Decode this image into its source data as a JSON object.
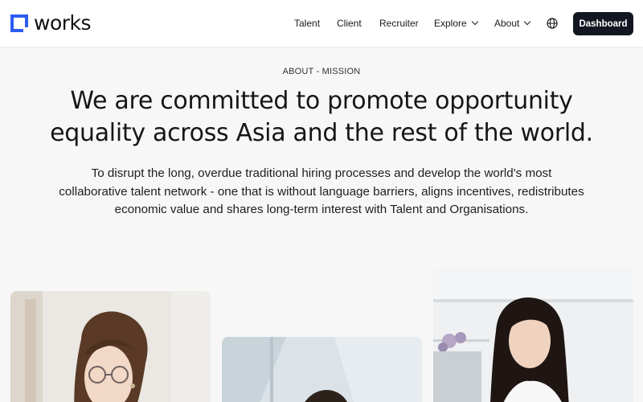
{
  "brand": {
    "name": "works",
    "logo_icon": "works-logo-mark",
    "accent": "#2f5cf0"
  },
  "nav": {
    "items": [
      {
        "label": "Talent",
        "has_dropdown": false
      },
      {
        "label": "Client",
        "has_dropdown": false
      },
      {
        "label": "Recruiter",
        "has_dropdown": false
      },
      {
        "label": "Explore",
        "has_dropdown": true
      },
      {
        "label": "About",
        "has_dropdown": true
      }
    ],
    "language_icon": "globe-icon",
    "cta_label": "Dashboard",
    "cta_color": "#131722"
  },
  "hero": {
    "eyebrow": "ABOUT - MISSION",
    "headline_line1": "We are committed to promote opportunity",
    "headline_line2": "equality across Asia and the rest of the world.",
    "desc_line1": "To disrupt the long, overdue traditional hiring processes and develop the world's most",
    "desc_line2": "collaborative talent network - one that is without language barriers, aligns incentives, redistributes",
    "desc_line3": "economic value and shares long-term interest with Talent and Organisations."
  },
  "photos": [
    {
      "subject": "woman-with-glasses-photo"
    },
    {
      "subject": "person-by-window-photo"
    },
    {
      "subject": "woman-long-hair-photo"
    }
  ]
}
